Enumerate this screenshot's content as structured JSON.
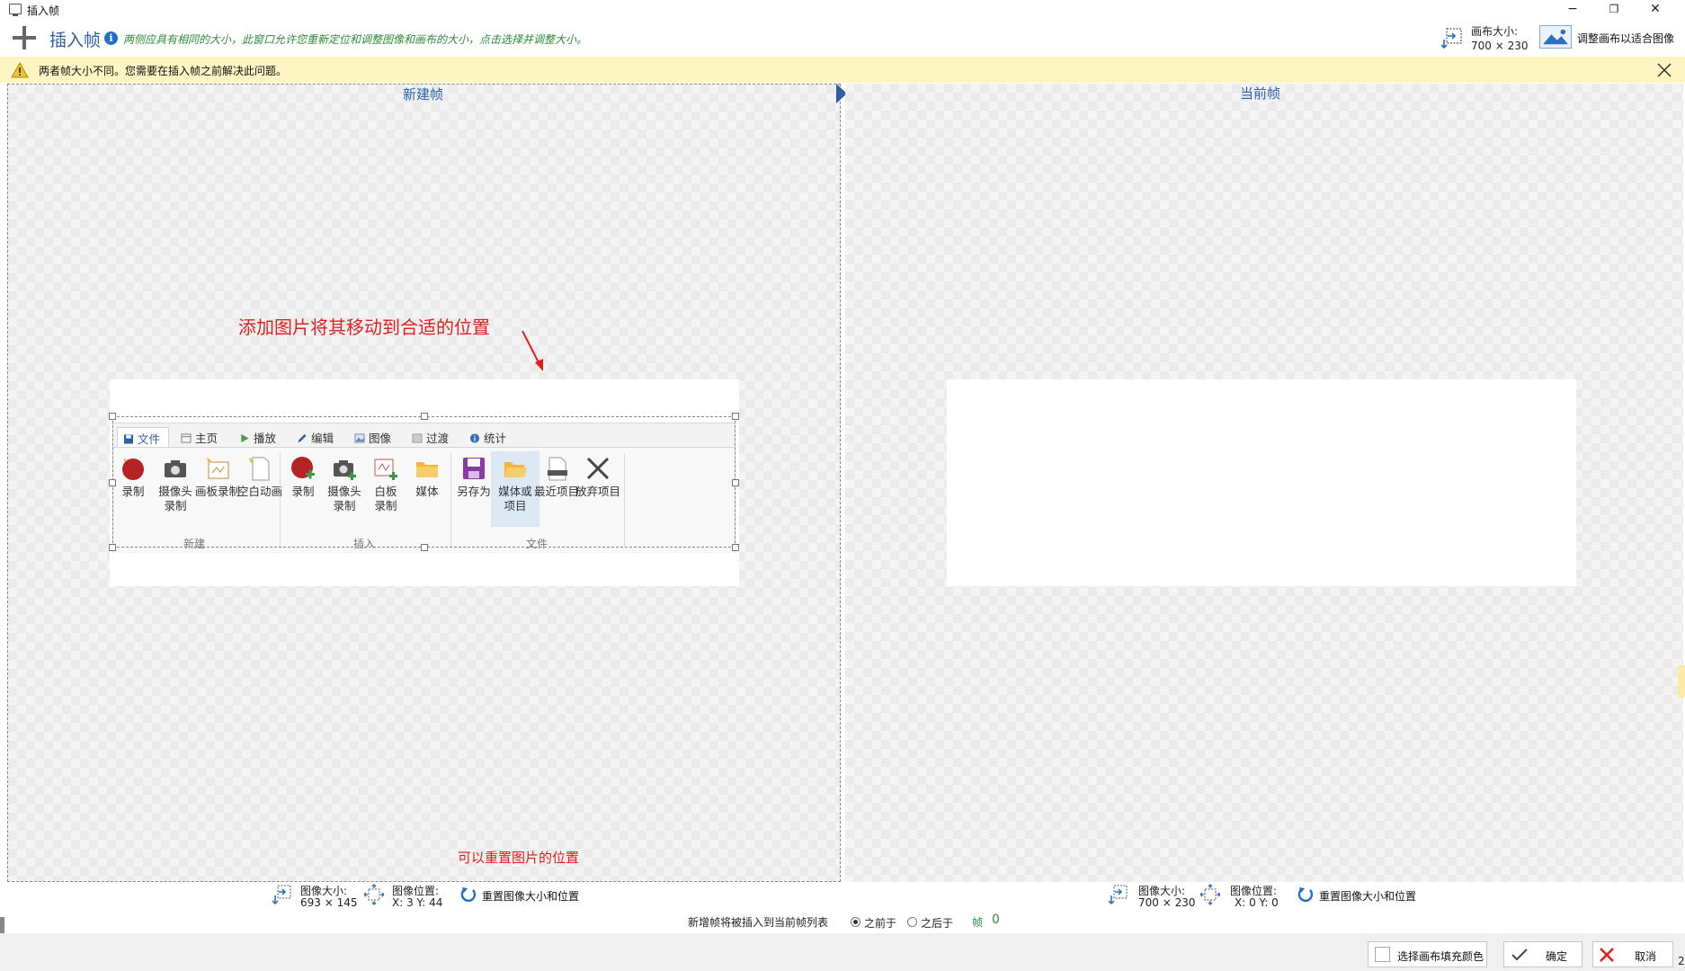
{
  "window": {
    "title": "插入帧",
    "minimize": "−",
    "restore": "❐",
    "close": "✕"
  },
  "header": {
    "title": "插入帧",
    "info": "i",
    "description": "两侧应具有相同的大小，此窗口允许您重新定位和调整图像和画布的大小，点击选择并调整大小。",
    "canvas_size_label": "画布大小:",
    "canvas_size_value": "700 × 230",
    "fit_canvas_label": "调整画布以适合图像"
  },
  "warning": {
    "text": "两者帧大小不同。您需要在插入帧之前解决此问题。"
  },
  "left_panel": {
    "title": "新建帧",
    "annotation_top": "添加图片将其移动到合适的位置",
    "annotation_bottom": "可以重置图片的位置",
    "image_size_label": "图像大小:",
    "image_size_value": "693 × 145",
    "image_pos_label": "图像位置:",
    "image_pos_value": "X: 3  Y: 44",
    "reset_label": "重置图像大小和位置"
  },
  "right_panel": {
    "title": "当前帧",
    "image_size_label": "图像大小:",
    "image_size_value": "700 × 230",
    "image_pos_label": "图像位置:",
    "image_pos_value": "X: 0  Y: 0",
    "reset_label": "重置图像大小和位置"
  },
  "ribbon": {
    "tabs": [
      "文件",
      "主页",
      "播放",
      "编辑",
      "图像",
      "过渡",
      "统计"
    ],
    "groups": {
      "new": {
        "label": "新建",
        "buttons": [
          "录制",
          "摄像头\n录制",
          "画板录制",
          "空白动画"
        ]
      },
      "insert": {
        "label": "插入",
        "buttons": [
          "录制",
          "摄像头\n录制",
          "白板\n录制",
          "媒体"
        ]
      },
      "file": {
        "label": "文件",
        "buttons": [
          "另存为",
          "媒体或\n项目",
          "最近项目",
          "放弃项目"
        ]
      }
    }
  },
  "insert_row": {
    "label": "新增帧将被插入到当前帧列表",
    "before": "之前于",
    "after": "之后于",
    "frame_label": "帧",
    "frame_value": "0",
    "selected": "before"
  },
  "footer": {
    "fill_color_label": "选择画布填充颜色",
    "ok_label": "确定",
    "cancel_label": "取消",
    "corner": "2"
  },
  "colors": {
    "accent_blue": "#2f5fa8",
    "annotation_red": "#e0201e",
    "hint_green": "#2e8b3c",
    "warning_bg": "#fdf6c2"
  }
}
